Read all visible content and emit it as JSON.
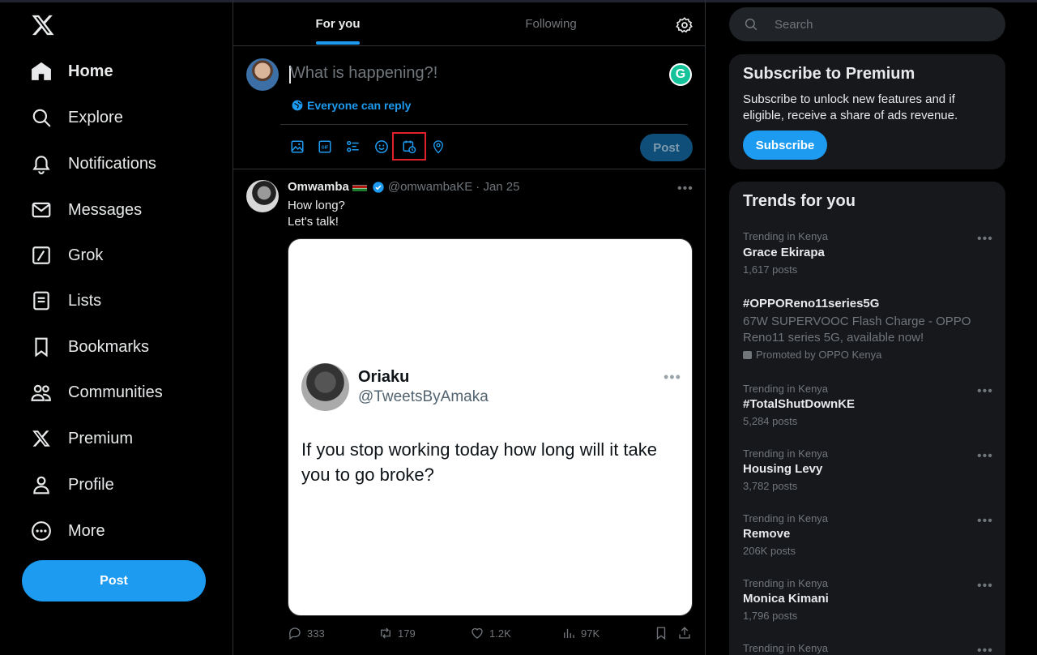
{
  "nav": {
    "items": [
      {
        "label": "Home",
        "icon": "home-icon"
      },
      {
        "label": "Explore",
        "icon": "search-icon"
      },
      {
        "label": "Notifications",
        "icon": "bell-icon"
      },
      {
        "label": "Messages",
        "icon": "envelope-icon"
      },
      {
        "label": "Grok",
        "icon": "grok-icon"
      },
      {
        "label": "Lists",
        "icon": "list-icon"
      },
      {
        "label": "Bookmarks",
        "icon": "bookmark-icon"
      },
      {
        "label": "Communities",
        "icon": "people-icon"
      },
      {
        "label": "Premium",
        "icon": "x-logo-icon"
      },
      {
        "label": "Profile",
        "icon": "person-icon"
      },
      {
        "label": "More",
        "icon": "more-circle-icon"
      }
    ],
    "post_label": "Post"
  },
  "tabs": {
    "for_you": "For you",
    "following": "Following"
  },
  "composer": {
    "placeholder": "What is happening?!",
    "reply_setting": "Everyone can reply",
    "post_label": "Post",
    "tools": [
      "image-icon",
      "gif-icon",
      "poll-icon",
      "emoji-icon",
      "schedule-icon",
      "location-icon"
    ]
  },
  "tweet": {
    "name": "Omwamba",
    "handle": "@omwambaKE",
    "date": "· Jan 25",
    "text_line1": "How long?",
    "text_line2": "Let's talk!",
    "media": {
      "name": "Oriaku",
      "handle": "@TweetsByAmaka",
      "text": "If you stop working today how long will it take you to go broke?"
    },
    "replies": "333",
    "reposts": "179",
    "likes": "1.2K",
    "views": "97K"
  },
  "search": {
    "placeholder": "Search"
  },
  "premium": {
    "title": "Subscribe to Premium",
    "desc": "Subscribe to unlock new features and if eligible, receive a share of ads revenue.",
    "button": "Subscribe"
  },
  "trends": {
    "title": "Trends for you",
    "t1": {
      "context": "Trending in Kenya",
      "name": "Grace Ekirapa",
      "count": "1,617 posts"
    },
    "promo": {
      "name": "#OPPOReno11series5G",
      "desc": "67W SUPERVOOC Flash Charge - OPPO Reno11 series 5G, available now!",
      "by": "Promoted by OPPO Kenya"
    },
    "t3": {
      "context": "Trending in Kenya",
      "name": "#TotalShutDownKE",
      "count": "5,284 posts"
    },
    "t4": {
      "context": "Trending in Kenya",
      "name": "Housing Levy",
      "count": "3,782 posts"
    },
    "t5": {
      "context": "Trending in Kenya",
      "name": "Remove",
      "count": "206K posts"
    },
    "t6": {
      "context": "Trending in Kenya",
      "name": "Monica Kimani",
      "count": "1,796 posts"
    },
    "t7": {
      "context": "Trending in Kenya"
    }
  },
  "colors": {
    "accent": "#1d9bf0",
    "background": "#000000",
    "panel": "#16181c",
    "highlight": "#e0212b"
  }
}
